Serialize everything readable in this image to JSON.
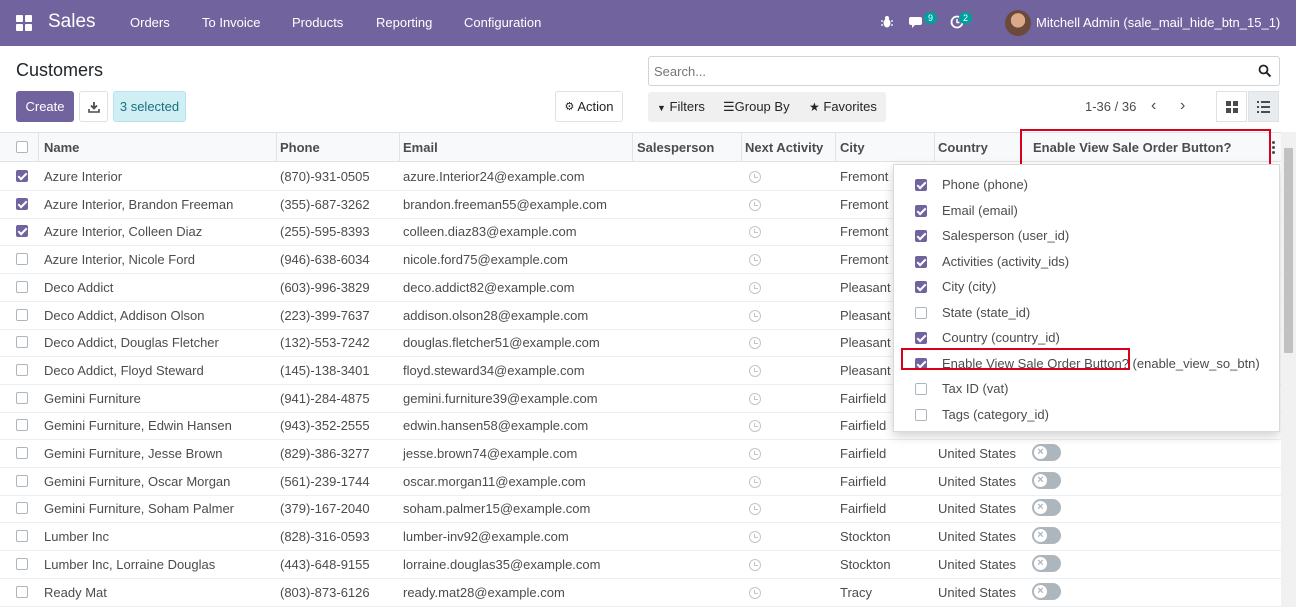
{
  "navbar": {
    "app_name": "Sales",
    "menu": [
      "Orders",
      "To Invoice",
      "Products",
      "Reporting",
      "Configuration"
    ],
    "messages_count": "9",
    "activities_count": "2",
    "user_name": "Mitchell Admin (sale_mail_hide_btn_15_1)"
  },
  "page": {
    "title": "Customers",
    "create_label": "Create",
    "selected_label": "3 selected",
    "action_label": "Action"
  },
  "search": {
    "placeholder": "Search...",
    "filters_label": "Filters",
    "groupby_label": "Group By",
    "favorites_label": "Favorites"
  },
  "pager": {
    "range": "1-36 / 36"
  },
  "table": {
    "headers": [
      "Name",
      "Phone",
      "Email",
      "Salesperson",
      "Next Activity",
      "City",
      "Country",
      "Enable View Sale Order Button?"
    ],
    "rows": [
      {
        "selected": true,
        "name": "Azure Interior",
        "phone": "(870)-931-0505",
        "email": "azure.Interior24@example.com",
        "city": "Fremont",
        "country": ""
      },
      {
        "selected": true,
        "name": "Azure Interior, Brandon Freeman",
        "phone": "(355)-687-3262",
        "email": "brandon.freeman55@example.com",
        "city": "Fremont",
        "country": ""
      },
      {
        "selected": true,
        "name": "Azure Interior, Colleen Diaz",
        "phone": "(255)-595-8393",
        "email": "colleen.diaz83@example.com",
        "city": "Fremont",
        "country": ""
      },
      {
        "selected": false,
        "name": "Azure Interior, Nicole Ford",
        "phone": "(946)-638-6034",
        "email": "nicole.ford75@example.com",
        "city": "Fremont",
        "country": ""
      },
      {
        "selected": false,
        "name": "Deco Addict",
        "phone": "(603)-996-3829",
        "email": "deco.addict82@example.com",
        "city": "Pleasant",
        "country": ""
      },
      {
        "selected": false,
        "name": "Deco Addict, Addison Olson",
        "phone": "(223)-399-7637",
        "email": "addison.olson28@example.com",
        "city": "Pleasant",
        "country": ""
      },
      {
        "selected": false,
        "name": "Deco Addict, Douglas Fletcher",
        "phone": "(132)-553-7242",
        "email": "douglas.fletcher51@example.com",
        "city": "Pleasant",
        "country": ""
      },
      {
        "selected": false,
        "name": "Deco Addict, Floyd Steward",
        "phone": "(145)-138-3401",
        "email": "floyd.steward34@example.com",
        "city": "Pleasant",
        "country": ""
      },
      {
        "selected": false,
        "name": "Gemini Furniture",
        "phone": "(941)-284-4875",
        "email": "gemini.furniture39@example.com",
        "city": "Fairfield",
        "country": ""
      },
      {
        "selected": false,
        "name": "Gemini Furniture, Edwin Hansen",
        "phone": "(943)-352-2555",
        "email": "edwin.hansen58@example.com",
        "city": "Fairfield",
        "country": ""
      },
      {
        "selected": false,
        "name": "Gemini Furniture, Jesse Brown",
        "phone": "(829)-386-3277",
        "email": "jesse.brown74@example.com",
        "city": "Fairfield",
        "country": "United States"
      },
      {
        "selected": false,
        "name": "Gemini Furniture, Oscar Morgan",
        "phone": "(561)-239-1744",
        "email": "oscar.morgan11@example.com",
        "city": "Fairfield",
        "country": "United States"
      },
      {
        "selected": false,
        "name": "Gemini Furniture, Soham Palmer",
        "phone": "(379)-167-2040",
        "email": "soham.palmer15@example.com",
        "city": "Fairfield",
        "country": "United States"
      },
      {
        "selected": false,
        "name": "Lumber Inc",
        "phone": "(828)-316-0593",
        "email": "lumber-inv92@example.com",
        "city": "Stockton",
        "country": "United States"
      },
      {
        "selected": false,
        "name": "Lumber Inc, Lorraine Douglas",
        "phone": "(443)-648-9155",
        "email": "lorraine.douglas35@example.com",
        "city": "Stockton",
        "country": "United States"
      },
      {
        "selected": false,
        "name": "Ready Mat",
        "phone": "(803)-873-6126",
        "email": "ready.mat28@example.com",
        "city": "Tracy",
        "country": "United States"
      }
    ]
  },
  "optional_columns": [
    {
      "label": "Phone (phone)",
      "checked": true
    },
    {
      "label": "Email (email)",
      "checked": true
    },
    {
      "label": "Salesperson (user_id)",
      "checked": true
    },
    {
      "label": "Activities (activity_ids)",
      "checked": true
    },
    {
      "label": "City (city)",
      "checked": true
    },
    {
      "label": "State (state_id)",
      "checked": false
    },
    {
      "label": "Country (country_id)",
      "checked": true
    },
    {
      "label": "Enable View Sale Order Button? (enable_view_so_btn)",
      "checked": true
    },
    {
      "label": "Tax ID (vat)",
      "checked": false
    },
    {
      "label": "Tags (category_id)",
      "checked": false
    }
  ],
  "colors": {
    "brand": "#71639e",
    "highlight": "#d9001b"
  }
}
